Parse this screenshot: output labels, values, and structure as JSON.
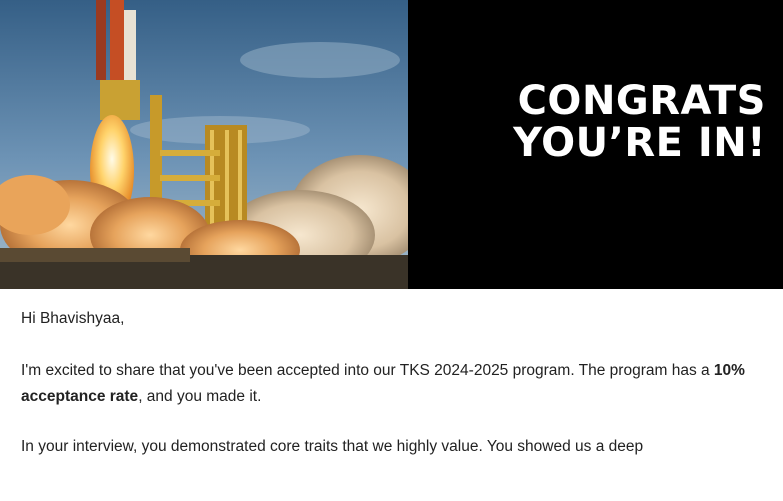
{
  "hero": {
    "headline_line1": "CONGRATS",
    "headline_line2": "YOU’RE IN!",
    "image_alt": "rocket-launch-photo",
    "background_color": "#000000",
    "text_color": "#ffffff"
  },
  "body": {
    "greeting": "Hi Bhavishyaa,",
    "para1_start": "I'm excited to share that you've been accepted into our TKS 2024-2025 program. The program has a ",
    "para1_bold": "10% acceptance rate",
    "para1_end": ", and you made it.",
    "para2": "In your interview, you demonstrated core traits that we highly value. You showed us a deep"
  }
}
